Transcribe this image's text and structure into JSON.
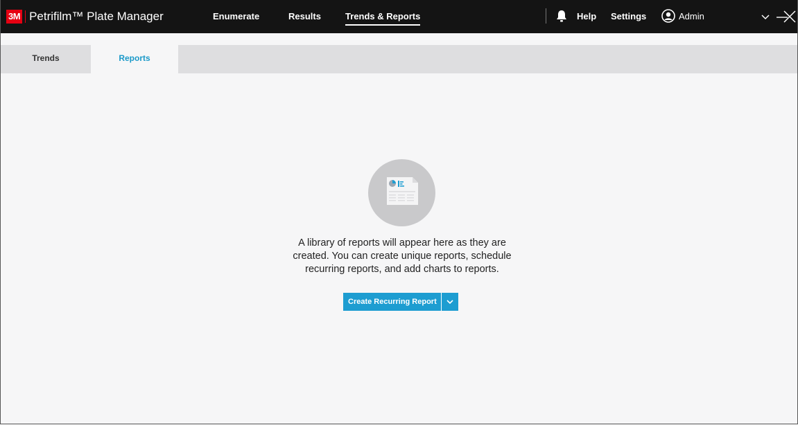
{
  "app": {
    "logo_text": "3M",
    "title": "Petrifilm™ Plate Manager"
  },
  "nav": {
    "items": [
      {
        "label": "Enumerate"
      },
      {
        "label": "Results"
      },
      {
        "label": "Trends & Reports"
      }
    ],
    "active": "Trends & Reports"
  },
  "toolbar": {
    "notifications_icon": "bell-icon",
    "help_label": "Help",
    "settings_label": "Settings",
    "user_icon": "user-circle-icon",
    "user_label": "Admin"
  },
  "window_controls": [
    "chevron-down-icon",
    "minimize-icon",
    "close-icon"
  ],
  "tabs": {
    "items": [
      {
        "label": "Trends"
      },
      {
        "label": "Reports"
      }
    ],
    "active": "Reports"
  },
  "empty_state": {
    "icon": "report-document-icon",
    "message_lines": [
      "A library of reports will appear here as they are",
      "created. You can create unique reports, schedule",
      "recurring reports, and add charts to reports."
    ]
  },
  "actions": {
    "create_label": "Create Recurring Report",
    "dropdown_icon": "chevron-down-icon"
  },
  "colors": {
    "titlebar_bg": "#141414",
    "brand_red": "#e60012",
    "accent_blue": "#1d9dd1",
    "tab_active_text": "#1a99c9",
    "content_bg": "#f6f6f7",
    "tabstrip_bg": "#dedee0"
  }
}
